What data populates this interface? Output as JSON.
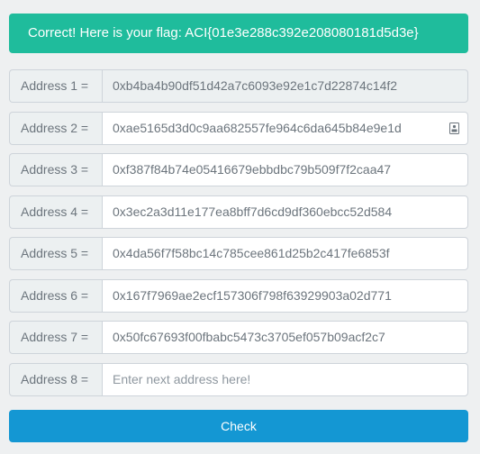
{
  "flag_message": "Correct! Here is your flag: ACI{01e3e288c392e208080181d5d3e}",
  "addresses": [
    {
      "label": "Address 1 =",
      "value": "0xb4ba4b90df51d42a7c6093e92e1c7d22874c14f2"
    },
    {
      "label": "Address 2 =",
      "value": "0xae5165d3d0c9aa682557fe964c6da645b84e9e1d"
    },
    {
      "label": "Address 3 =",
      "value": "0xf387f84b74e05416679ebbdbc79b509f7f2caa47"
    },
    {
      "label": "Address 4 =",
      "value": "0x3ec2a3d11e177ea8bff7d6cd9df360ebcc52d584"
    },
    {
      "label": "Address 5 =",
      "value": "0x4da56f7f58bc14c785cee861d25b2c417fe6853f"
    },
    {
      "label": "Address 6 =",
      "value": "0x167f7969ae2ecf157306f798f63929903a02d771"
    },
    {
      "label": "Address 7 =",
      "value": "0x50fc67693f00fbabc5473c3705ef057b09acf2c7"
    },
    {
      "label": "Address 8 =",
      "value": "",
      "placeholder": "Enter next address here!"
    }
  ],
  "check_label": "Check",
  "icons": {
    "field_icon": "contact-card-icon"
  },
  "colors": {
    "success": "#1fbc9c",
    "primary": "#1497d3"
  }
}
